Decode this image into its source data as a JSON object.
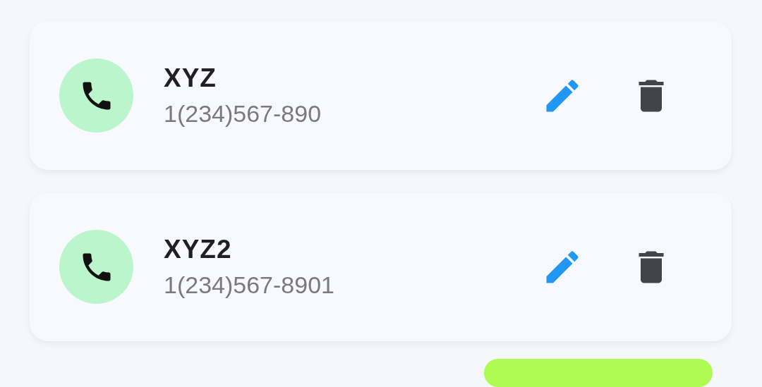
{
  "contacts": [
    {
      "name": "XYZ",
      "phone": "1(234)567-890"
    },
    {
      "name": "XYZ2",
      "phone": "1(234)567-8901"
    }
  ]
}
